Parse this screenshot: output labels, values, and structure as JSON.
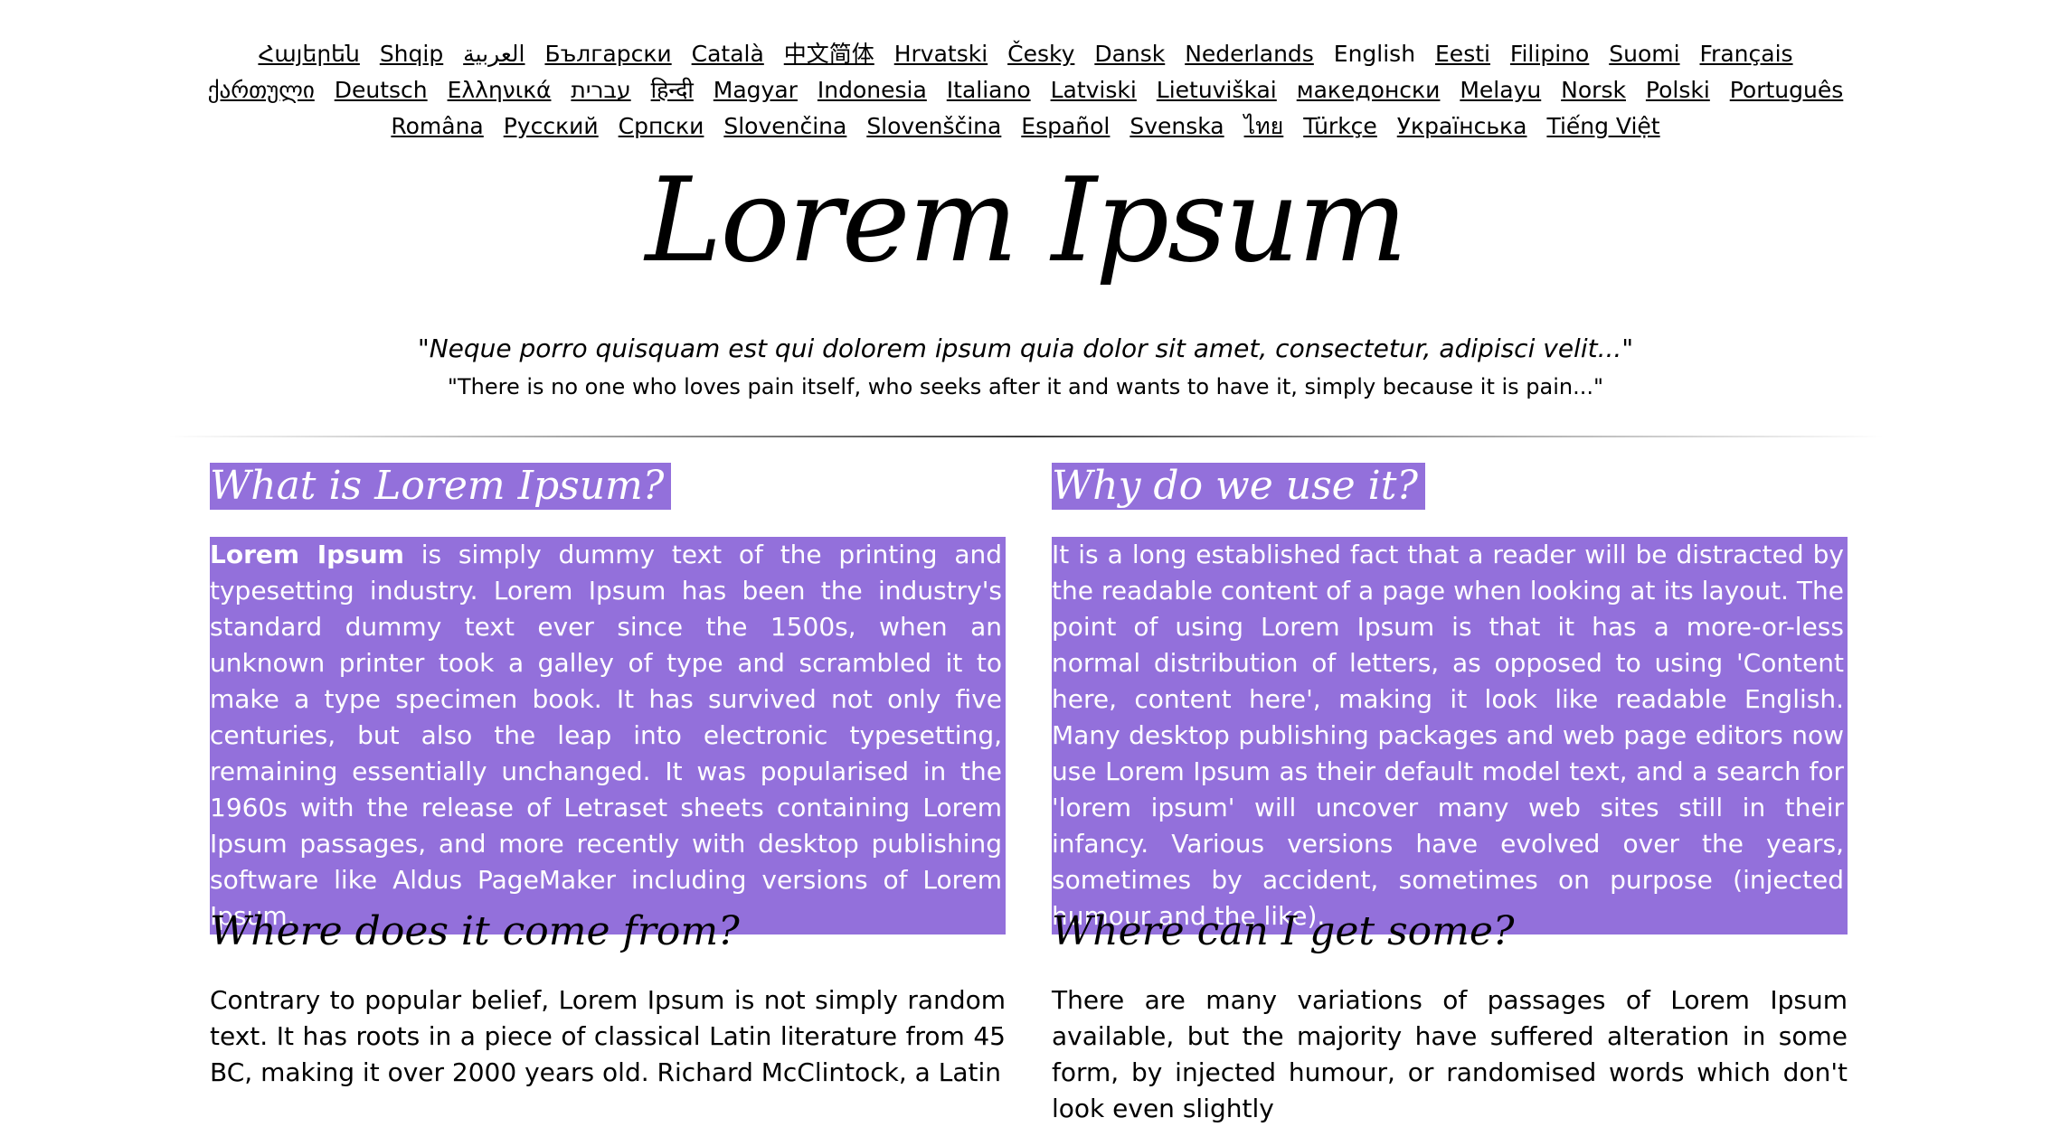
{
  "languages": [
    {
      "label": "Հայերեն",
      "link": true
    },
    {
      "label": "Shqip",
      "link": true
    },
    {
      "label": "العربية",
      "link": true
    },
    {
      "label": "Български",
      "link": true
    },
    {
      "label": "Català",
      "link": true
    },
    {
      "label": "中文简体",
      "link": true
    },
    {
      "label": "Hrvatski",
      "link": true
    },
    {
      "label": "Česky",
      "link": true
    },
    {
      "label": "Dansk",
      "link": true
    },
    {
      "label": "Nederlands",
      "link": true
    },
    {
      "label": "English",
      "link": false
    },
    {
      "label": "Eesti",
      "link": true
    },
    {
      "label": "Filipino",
      "link": true
    },
    {
      "label": "Suomi",
      "link": true
    },
    {
      "label": "Français",
      "link": true
    },
    {
      "label": "ქართული",
      "link": true
    },
    {
      "label": "Deutsch",
      "link": true
    },
    {
      "label": "Ελληνικά",
      "link": true
    },
    {
      "label": "עברית",
      "link": true
    },
    {
      "label": "हिन्दी",
      "link": true
    },
    {
      "label": "Magyar",
      "link": true
    },
    {
      "label": "Indonesia",
      "link": true
    },
    {
      "label": "Italiano",
      "link": true
    },
    {
      "label": "Latviski",
      "link": true
    },
    {
      "label": "Lietuviškai",
      "link": true
    },
    {
      "label": "македонски",
      "link": true
    },
    {
      "label": "Melayu",
      "link": true
    },
    {
      "label": "Norsk",
      "link": true
    },
    {
      "label": "Polski",
      "link": true
    },
    {
      "label": "Português",
      "link": true
    },
    {
      "label": "Româna",
      "link": true
    },
    {
      "label": "Pyccкий",
      "link": true
    },
    {
      "label": "Српски",
      "link": true
    },
    {
      "label": "Slovenčina",
      "link": true
    },
    {
      "label": "Slovenščina",
      "link": true
    },
    {
      "label": "Español",
      "link": true
    },
    {
      "label": "Svenska",
      "link": true
    },
    {
      "label": "ไทย",
      "link": true
    },
    {
      "label": "Türkçe",
      "link": true
    },
    {
      "label": "Українська",
      "link": true
    },
    {
      "label": "Tiếng Việt",
      "link": true
    }
  ],
  "header": {
    "title": "Lorem Ipsum",
    "quote_latin": "\"Neque porro quisquam est qui dolorem ipsum quia dolor sit amet, consectetur, adipisci velit...\"",
    "quote_english": "\"There is no one who loves pain itself, who seeks after it and wants to have it, simply because it is pain...\""
  },
  "sections": {
    "what": {
      "heading": "What is Lorem Ipsum?",
      "bold_lead": "Lorem Ipsum",
      "body": " is simply dummy text of the printing and typesetting industry. Lorem Ipsum has been the industry's standard dummy text ever since the 1500s, when an unknown printer took a galley of type and scrambled it to make a type specimen book. It has survived not only five centuries, but also the leap into electronic typesetting, remaining essentially unchanged. It was popularised in the 1960s with the release of Letraset sheets containing Lorem Ipsum passages, and more recently with desktop publishing software like Aldus PageMaker including versions of Lorem Ipsum."
    },
    "why": {
      "heading": "Why do we use it?",
      "body": "It is a long established fact that a reader will be distracted by the readable content of a page when looking at its layout. The point of using Lorem Ipsum is that it has a more-or-less normal distribution of letters, as opposed to using 'Content here, content here', making it look like readable English. Many desktop publishing packages and web page editors now use Lorem Ipsum as their default model text, and a search for 'lorem ipsum' will uncover many web sites still in their infancy. Various versions have evolved over the years, sometimes by accident, sometimes on purpose (injected humour and the like)."
    },
    "where_from": {
      "heading": "Where does it come from?",
      "body": "Contrary to popular belief, Lorem Ipsum is not simply random text. It has roots in a piece of classical Latin literature from 45 BC, making it over 2000 years old. Richard McClintock, a Latin"
    },
    "where_get": {
      "heading": "Where can I get some?",
      "body": "There are many variations of passages of Lorem Ipsum available, but the majority have suffered alteration in some form, by injected humour, or randomised words which don't look even slightly"
    }
  },
  "colors": {
    "selection_highlight": "#9370db",
    "text": "#000000",
    "background": "#ffffff"
  }
}
